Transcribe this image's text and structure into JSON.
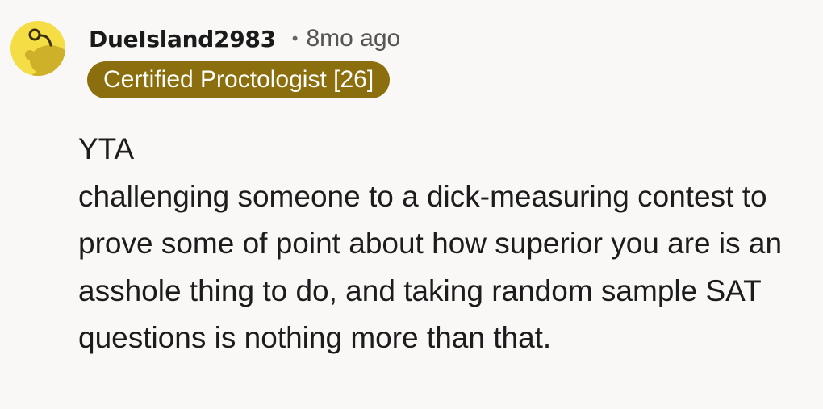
{
  "comment": {
    "author": "DueIsland2983",
    "separator": "•",
    "timestamp": "8mo ago",
    "flair": "Certified Proctologist [26]",
    "verdict": "YTA",
    "body": "challenging someone to a dick-measuring contest to prove some of point about how superior you are is an asshole thing to do, and taking random sample SAT questions is nothing more than that.",
    "avatar_icon": "reddit-snoo-avatar-icon",
    "colors": {
      "avatar_bg": "#f5dd45",
      "flair_bg": "#8b6f0e",
      "flair_text": "#ffffff",
      "background": "#f9f8f6"
    }
  }
}
